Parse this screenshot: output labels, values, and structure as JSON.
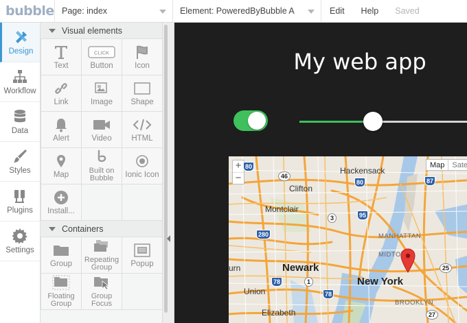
{
  "topbar": {
    "logo": "bubble",
    "page_dropdown": "Page: index",
    "element_dropdown": "Element: PoweredByBubble A",
    "menu": [
      "Edit",
      "Help"
    ],
    "status": "Saved"
  },
  "leftnav": {
    "tabs": [
      {
        "label": "Design",
        "icon": "design-icon",
        "active": true
      },
      {
        "label": "Workflow",
        "icon": "workflow-icon"
      },
      {
        "label": "Data",
        "icon": "database-icon"
      },
      {
        "label": "Styles",
        "icon": "brush-icon"
      },
      {
        "label": "Plugins",
        "icon": "plug-icon"
      },
      {
        "label": "Settings",
        "icon": "gear-icon"
      }
    ]
  },
  "palette": {
    "visual_header": "Visual elements",
    "visual": {
      "text": "Text",
      "button": "Button",
      "button_badge": "CLICK",
      "icon": "Icon",
      "link": "Link",
      "image": "Image",
      "shape": "Shape",
      "alert": "Alert",
      "video": "Video",
      "html": "HTML",
      "map": "Map",
      "built_on_1": "Built on",
      "built_on_2": "Bubble",
      "ionic": "Ionic Icon",
      "install": "Install..."
    },
    "containers_header": "Containers",
    "containers": {
      "group": "Group",
      "repeating_1": "Repeating",
      "repeating_2": "Group",
      "popup": "Popup",
      "floating_1": "Floating",
      "floating_2": "Group",
      "groupfocus_1": "Group",
      "groupfocus_2": "Focus"
    }
  },
  "canvas": {
    "title": "My web app",
    "toggle_on": true,
    "slider_value_fraction": 0.44,
    "map": {
      "zoom_in": "+",
      "zoom_out": "−",
      "type_map": "Map",
      "type_satellite": "Sate",
      "places": {
        "hackensack": "Hackensack",
        "clifton": "Clifton",
        "montclair": "Montclair",
        "manhattan": "MANHATTAN",
        "midtown": "MIDTOWN",
        "newark": "Newark",
        "newyork": "New York",
        "union": "Union",
        "elizabeth": "Elizabeth",
        "brooklyn": "BROOKLYN",
        "urn": "urn"
      },
      "shields": {
        "i80a": "80",
        "r46": "46",
        "i80b": "80",
        "r87": "87",
        "r3": "3",
        "i95": "95",
        "i280": "280",
        "r25": "25",
        "i78a": "78",
        "r1": "1",
        "i78b": "78",
        "r27": "27"
      }
    }
  },
  "colors": {
    "accent": "#3b97d3",
    "toggle_green": "#3fc05c",
    "highway": "#f4a53a",
    "water": "#a8c8e8",
    "canvas_bg": "#1e1e1e"
  }
}
